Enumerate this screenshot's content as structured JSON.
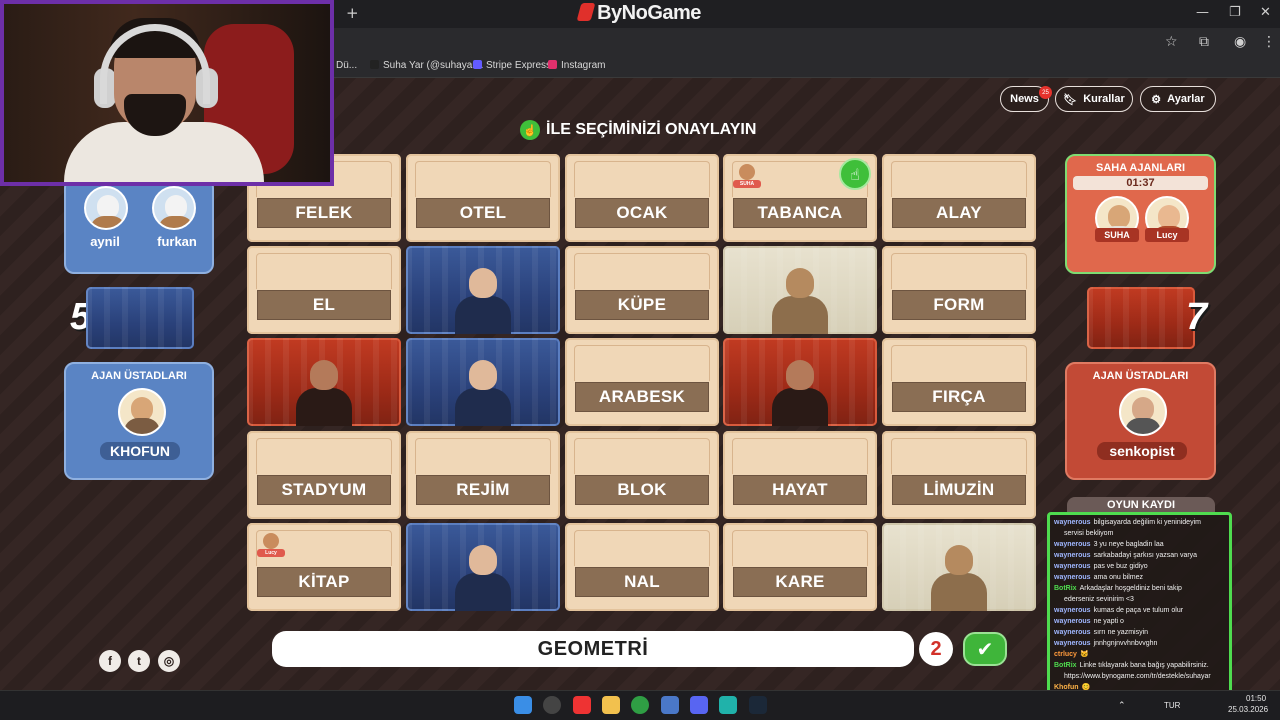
{
  "browser": {
    "brand": "ByNoGame",
    "new_tab": "+",
    "bookmarks": [
      {
        "label": "Dü...",
        "color": "#888888"
      },
      {
        "label": "Suha Yar (@suhayar...",
        "color": "#222222"
      },
      {
        "label": "Stripe Express",
        "color": "#635bff"
      },
      {
        "label": "Instagram",
        "color": "#e1306c"
      }
    ]
  },
  "header": {
    "news_label": "News",
    "news_badge": "25",
    "rules_label": "Kurallar",
    "settings_label": "Ayarlar"
  },
  "instruction": "İLE SEÇİMİNİZİ ONAYLAYIN",
  "board": {
    "rows": [
      [
        {
          "type": "word",
          "word": "FELEK"
        },
        {
          "type": "word",
          "word": "OTEL"
        },
        {
          "type": "word",
          "word": "OCAK"
        },
        {
          "type": "word",
          "word": "TABANCA",
          "marker": "SUHA",
          "confirm": true
        },
        {
          "type": "word",
          "word": "ALAY"
        }
      ],
      [
        {
          "type": "word",
          "word": "EL"
        },
        {
          "type": "agent",
          "team": "blue"
        },
        {
          "type": "word",
          "word": "KÜPE"
        },
        {
          "type": "agent",
          "team": "neutral"
        },
        {
          "type": "word",
          "word": "FORM"
        }
      ],
      [
        {
          "type": "agent",
          "team": "red"
        },
        {
          "type": "agent",
          "team": "blue"
        },
        {
          "type": "word",
          "word": "ARABESK"
        },
        {
          "type": "agent",
          "team": "red"
        },
        {
          "type": "word",
          "word": "FIRÇA"
        }
      ],
      [
        {
          "type": "word",
          "word": "STADYUM"
        },
        {
          "type": "word",
          "word": "REJİM"
        },
        {
          "type": "word",
          "word": "BLOK"
        },
        {
          "type": "word",
          "word": "HAYAT"
        },
        {
          "type": "word",
          "word": "LİMUZİN"
        }
      ],
      [
        {
          "type": "word",
          "word": "KİTAP",
          "marker": "Lucy"
        },
        {
          "type": "agent",
          "team": "blue"
        },
        {
          "type": "word",
          "word": "NAL"
        },
        {
          "type": "word",
          "word": "KARE"
        },
        {
          "type": "agent",
          "team": "neutral"
        }
      ]
    ]
  },
  "blue_team": {
    "operatives": [
      "aynil",
      "furkan"
    ],
    "score": "5",
    "spymaster_title": "AJAN ÜSTADLARI",
    "spymaster": "KHOFUN"
  },
  "red_team": {
    "operatives_title": "SAHA AJANLARI",
    "timer": "01:37",
    "operatives": [
      "SUHA",
      "Lucy"
    ],
    "score": "7",
    "spymaster_title": "AJAN ÜSTADLARI",
    "spymaster": "senkopist"
  },
  "clue": {
    "word": "GEOMETRİ",
    "count": "2"
  },
  "game_log": {
    "title": "OYUN KAYDI",
    "messages": [
      {
        "user": "waynerous",
        "text": "bilgisayarda değilim ki yeninideyim",
        "color": "#9fb6ff"
      },
      {
        "user": "",
        "text": "servisi bekliyom",
        "color": "#9fb6ff"
      },
      {
        "user": "waynerous",
        "text": "3 yu neye bagladin laa",
        "color": "#9fb6ff"
      },
      {
        "user": "waynerous",
        "text": "sarkabadayi şarkısı yazsan varya",
        "color": "#9fb6ff"
      },
      {
        "user": "waynerous",
        "text": "pas ve buz gidiyo",
        "color": "#9fb6ff"
      },
      {
        "user": "waynerous",
        "text": "ama onu bilmez",
        "color": "#9fb6ff"
      },
      {
        "user": "BotRix",
        "text": "Arkadaşlar hoşgeldiniz beni takip",
        "color": "#4fdc4f"
      },
      {
        "user": "",
        "text": "ederseniz sevinirim <3",
        "color": "#4fdc4f"
      },
      {
        "user": "waynerous",
        "text": "kumas de paça ve tulum olur",
        "color": "#9fb6ff"
      },
      {
        "user": "waynerous",
        "text": "ne yapti o",
        "color": "#9fb6ff"
      },
      {
        "user": "waynerous",
        "text": "sırrı ne yazmisyin",
        "color": "#9fb6ff"
      },
      {
        "user": "waynerous",
        "text": "jnnhgnjnvvhnbvvghn",
        "color": "#9fb6ff"
      },
      {
        "user": "ctrlucy",
        "text": "🐱",
        "color": "#ff9a3c"
      },
      {
        "user": "BotRix",
        "text": "Linke tıklayarak bana bağış yapabilirsiniz.",
        "color": "#4fdc4f"
      },
      {
        "user": "",
        "text": "https://www.bynogame.com/tr/destekle/suhayar",
        "color": "#4fdc4f"
      },
      {
        "user": "Khofun",
        "text": "😊",
        "color": "#ffb347"
      }
    ]
  },
  "taskbar": {
    "lang": "TUR",
    "time": "01:50",
    "date": "25.03.2026"
  },
  "colors": {
    "blue_team": "#4a6fb0",
    "red_team": "#c24a36",
    "confirm_green": "#3fbf3a",
    "card_beige": "#f0d7b7"
  }
}
